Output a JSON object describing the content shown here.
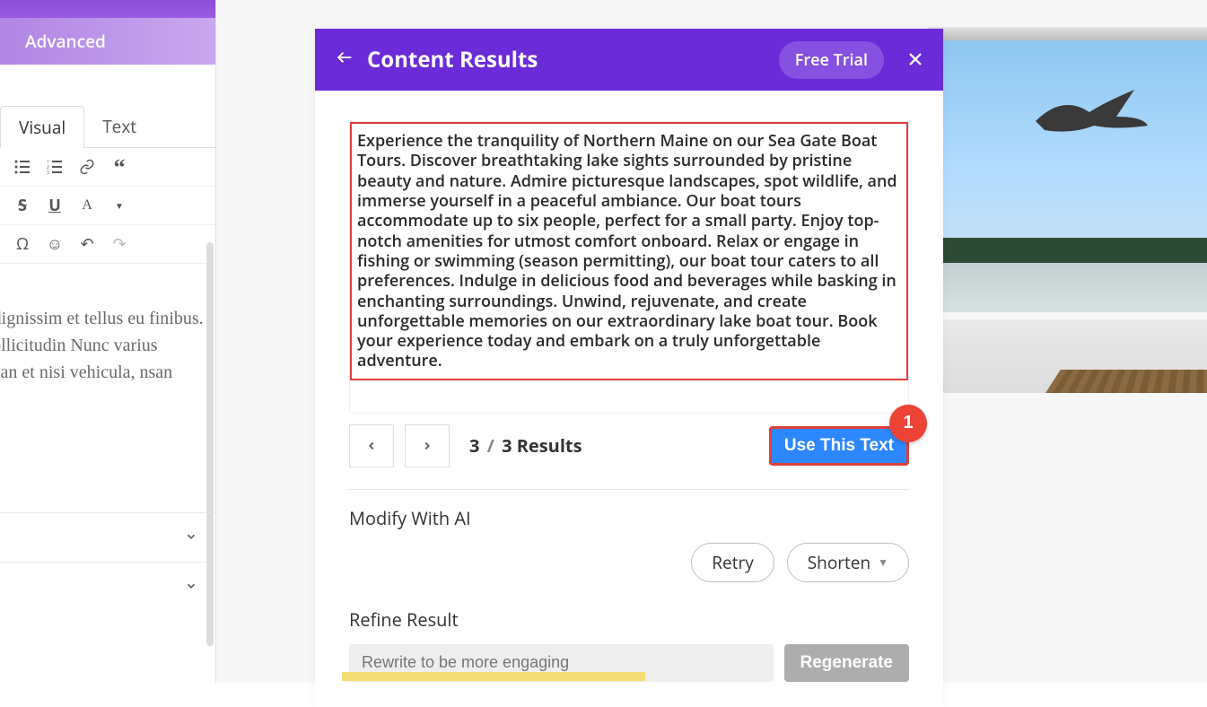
{
  "sidebar": {
    "advanced_label": "Advanced",
    "tabs": {
      "visual": "Visual",
      "text": "Text"
    }
  },
  "bg_text": "nc, nec dignissim et tellus eu finibus. scipit, sollicitudin Nunc varius sagittis ean et nisi vehicula, nsan neque.",
  "modal": {
    "title": "Content Results",
    "free_trial": "Free Trial",
    "result_text": "Experience the tranquility of Northern Maine on our Sea Gate Boat Tours. Discover breathtaking lake sights surrounded by pristine beauty and nature. Admire picturesque landscapes, spot wildlife, and immerse yourself in a peaceful ambiance. Our boat tours accommodate up to six people, perfect for a small party. Enjoy top-notch amenities for utmost comfort onboard. Relax or engage in fishing or swimming (season permitting), our boat tour caters to all preferences. Indulge in delicious food and beverages while basking in enchanting surroundings. Unwind, rejuvenate, and create unforgettable memories on our extraordinary lake boat tour. Book your experience today and embark on a truly unforgettable adventure.",
    "current_result": "3",
    "total_results": "3 Results",
    "use_text_label": "Use This Text",
    "marker": "1",
    "modify_label": "Modify With AI",
    "retry_label": "Retry",
    "shorten_label": "Shorten",
    "refine_label": "Refine Result",
    "refine_placeholder": "Rewrite to be more engaging",
    "regenerate_label": "Regenerate"
  }
}
